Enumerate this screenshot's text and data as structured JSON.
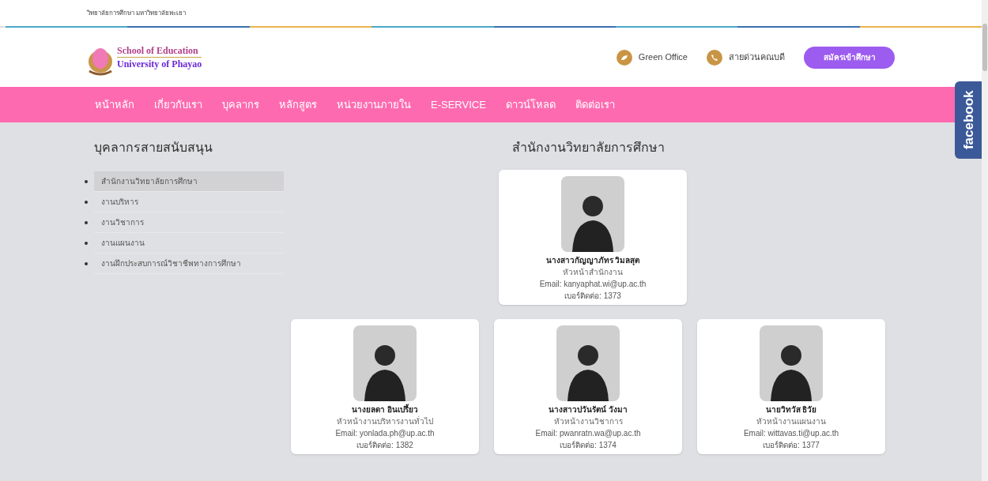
{
  "top_bar": {
    "text": "วิทยาลัยการศึกษา มหาวิทยาลัยพะเยา"
  },
  "logo": {
    "line_1": "School of Education",
    "line_2": "University of Phayao"
  },
  "header_links": [
    {
      "kind": "leaf",
      "label": "Green Office"
    },
    {
      "kind": "phone",
      "label": "สายด่วนคณบดี"
    }
  ],
  "apply_button": "สมัครเข้าศึกษา",
  "nav": [
    "หน้าหลัก",
    "เกี่ยวกับเรา",
    "บุคลากร",
    "หลักสูตร",
    "หน่วยงานภายใน",
    "E-SERVICE",
    "ดาวน์โหลด",
    "ติดต่อเรา"
  ],
  "sidebar": {
    "title": "บุคลากรสายสนับสนุน",
    "items": [
      {
        "label": "สำนักงานวิทยาลัยการศึกษา",
        "selected": true
      },
      {
        "label": "งานบริหาร",
        "selected": false
      },
      {
        "label": "งานวิชาการ",
        "selected": false
      },
      {
        "label": "งานแผนงาน",
        "selected": false
      },
      {
        "label": "งานฝึกประสบการณ์วิชาชีพทางการศึกษา",
        "selected": false
      }
    ]
  },
  "section_title": "สำนักงานวิทยาลัยการศึกษา",
  "head": {
    "name": "นางสาวกัญญาภัทร วิมลสุต",
    "role": "หัวหน้าสำนักงาน",
    "email": "Email: kanyaphat.wi@up.ac.th",
    "phone": "เบอร์ติดต่อ: 1373"
  },
  "staff": [
    {
      "name": "นางยลดา อินเปรี้ยว",
      "role": "หัวหน้างานบริหารงานทั่วไป",
      "email": "Email: yonlada.ph@up.ac.th",
      "phone": "เบอร์ติดต่อ: 1382"
    },
    {
      "name": "นางสาวปวันรัตน์ วังมา",
      "role": "หัวหน้างานวิชาการ",
      "email": "Email: pwanratn.wa@up.ac.th",
      "phone": "เบอร์ติดต่อ: 1374"
    },
    {
      "name": "นายวิทวัส ธิวัย",
      "role": "หัวหน้างานแผนงาน",
      "email": "Email: wittavas.ti@up.ac.th",
      "phone": "เบอร์ติดต่อ: 1377"
    }
  ],
  "side_tab": "facebook"
}
